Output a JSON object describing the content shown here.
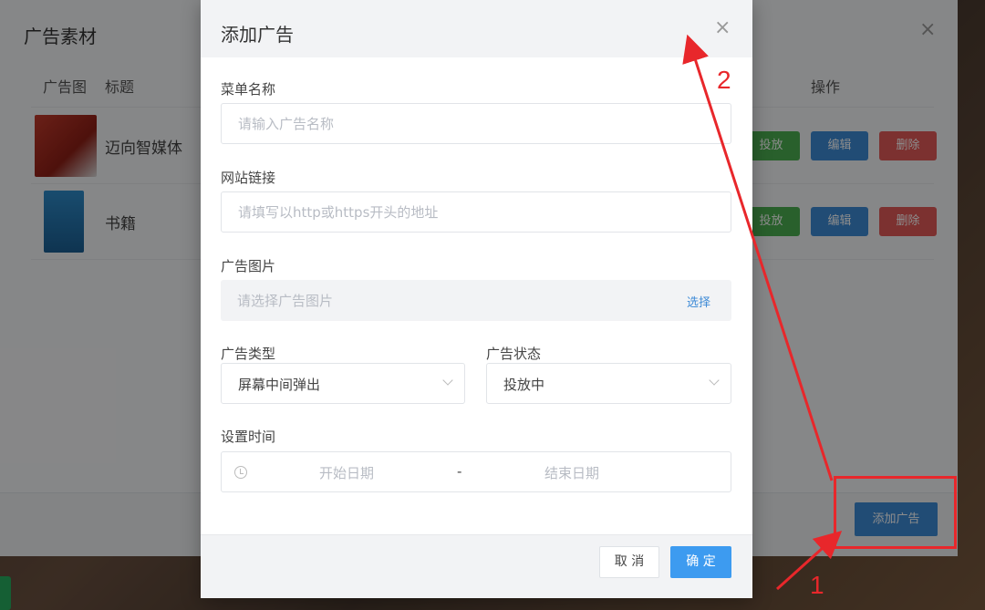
{
  "outer": {
    "title": "广告素材",
    "close": "×",
    "columns": {
      "image": "广告图",
      "title": "标题",
      "actions": "操作"
    },
    "rows": [
      {
        "title": "迈向智媒体",
        "publish": "投放",
        "edit": "编辑",
        "delete": "删除"
      },
      {
        "title": "书籍",
        "publish": "投放",
        "edit": "编辑",
        "delete": "删除"
      }
    ],
    "add_button": "添加广告"
  },
  "modal": {
    "title": "添加广告",
    "close": "×",
    "menu_name": {
      "label": "菜单名称",
      "placeholder": "请输入广告名称"
    },
    "site_link": {
      "label": "网站链接",
      "placeholder": "请填写以http或https开头的地址"
    },
    "ad_image": {
      "label": "广告图片",
      "placeholder": "请选择广告图片",
      "select": "选择"
    },
    "ad_type": {
      "label": "广告类型",
      "value": "屏幕中间弹出"
    },
    "ad_status": {
      "label": "广告状态",
      "value": "投放中"
    },
    "set_time": {
      "label": "设置时间",
      "start": "开始日期",
      "separator": "-",
      "end": "结束日期"
    },
    "cancel": "取 消",
    "confirm": "确 定"
  },
  "annotations": {
    "one": "1",
    "two": "2",
    "color": "#e8272b"
  },
  "colors": {
    "primary": "#3d9bf0",
    "publish": "#4caf50",
    "edit": "#3d8ad6",
    "delete": "#e25a58"
  }
}
